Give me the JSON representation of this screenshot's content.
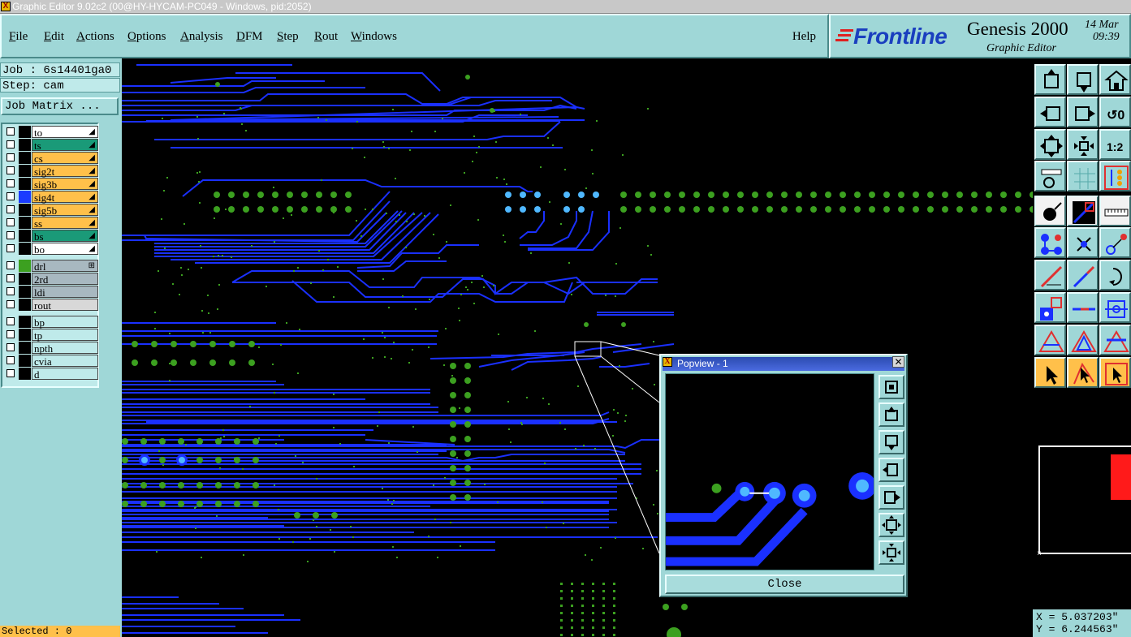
{
  "window": {
    "title": "Graphic Editor 9.02c2 (00@HY-HYCAM-PC049 - Windows, pid:2052)"
  },
  "menu": {
    "items": [
      "File",
      "Edit",
      "Actions",
      "Options",
      "Analysis",
      "DFM",
      "Step",
      "Rout",
      "Windows"
    ],
    "help": "Help"
  },
  "logo": {
    "brand": "Frontline",
    "product": "Genesis 2000",
    "subtitle": "Graphic Editor",
    "date": "14 Mar",
    "time": "09:39"
  },
  "job": {
    "job_label": "Job : 6s14401ga0",
    "step_label": "Step: cam",
    "job_matrix_button": "Job Matrix ..."
  },
  "layers": {
    "group1": [
      {
        "name": "to",
        "color": "#ffffff",
        "swatch": "#000000"
      },
      {
        "name": "ts",
        "color": "#1a9a78",
        "swatch": "#000000"
      },
      {
        "name": "cs",
        "color": "#ffc04a",
        "swatch": "#000000"
      },
      {
        "name": "sig2t",
        "color": "#ffc04a",
        "swatch": "#000000"
      },
      {
        "name": "sig3b",
        "color": "#ffc04a",
        "swatch": "#000000"
      },
      {
        "name": "sig4t",
        "color": "#ffc04a",
        "swatch": "#1a3cff"
      },
      {
        "name": "sig5b",
        "color": "#ffc04a",
        "swatch": "#000000"
      },
      {
        "name": "ss",
        "color": "#ffc04a",
        "swatch": "#000000"
      },
      {
        "name": "bs",
        "color": "#1a9a78",
        "swatch": "#000000"
      },
      {
        "name": "bo",
        "color": "#ffffff",
        "swatch": "#000000"
      }
    ],
    "group2": [
      {
        "name": "drl",
        "color": "#a8b8c0",
        "swatch": "#3ca020"
      },
      {
        "name": "2rd",
        "color": "#a8b8c0",
        "swatch": "#000000"
      },
      {
        "name": "ldi",
        "color": "#a8b8c0",
        "swatch": "#000000"
      },
      {
        "name": "rout",
        "color": "#d8d8d8",
        "swatch": "#000000"
      }
    ],
    "group3": [
      {
        "name": "bp",
        "color": "#bfeaea",
        "swatch": "#000000"
      },
      {
        "name": "tp",
        "color": "#bfeaea",
        "swatch": "#000000"
      },
      {
        "name": "npth",
        "color": "#bfeaea",
        "swatch": "#000000"
      },
      {
        "name": "cvia",
        "color": "#bfeaea",
        "swatch": "#000000"
      },
      {
        "name": "d",
        "color": "#bfeaea",
        "swatch": "#000000"
      }
    ]
  },
  "status": {
    "selected": "Selected : 0"
  },
  "popview": {
    "title": "Popview - 1",
    "close_button": "Close"
  },
  "coords": {
    "x": "X = 5.037203\"",
    "y": "Y = 6.244563\""
  },
  "colors": {
    "trace": "#1a30ff",
    "pad": "#3ca020",
    "highlight_pad": "#4fb8ff",
    "panel": "#9fd7d7"
  }
}
